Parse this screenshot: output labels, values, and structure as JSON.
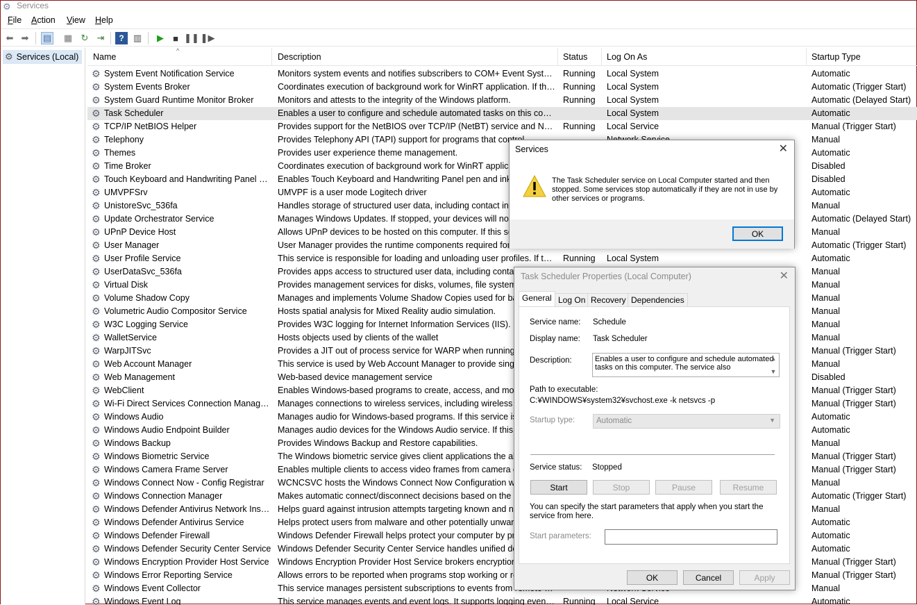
{
  "window": {
    "title": "Services"
  },
  "menu": [
    "File",
    "Action",
    "View",
    "Help"
  ],
  "menu_underline": [
    "F",
    "A",
    "V",
    "H"
  ],
  "toolbar": [
    "back-icon",
    "forward-icon",
    "console-tree-icon",
    "properties-icon",
    "refresh-icon",
    "export-icon",
    "help-icon",
    "show-hide-icon",
    "start-service-icon",
    "stop-service-icon",
    "pause-service-icon",
    "restart-service-icon"
  ],
  "tree": {
    "root": "Services (Local)"
  },
  "columns": {
    "name": "Name",
    "description": "Description",
    "status": "Status",
    "logon": "Log On As",
    "startup": "Startup Type"
  },
  "rows": [
    {
      "name": "System Event Notification Service",
      "desc": "Monitors system events and notifies subscribers to COM+ Event System o...",
      "status": "Running",
      "logon": "Local System",
      "startup": "Automatic"
    },
    {
      "name": "System Events Broker",
      "desc": "Coordinates execution of background work for WinRT application. If this s...",
      "status": "Running",
      "logon": "Local System",
      "startup": "Automatic (Trigger Start)"
    },
    {
      "name": "System Guard Runtime Monitor Broker",
      "desc": "Monitors and attests to the integrity of the Windows platform.",
      "status": "Running",
      "logon": "Local System",
      "startup": "Automatic (Delayed Start)"
    },
    {
      "name": "Task Scheduler",
      "desc": "Enables a user to configure and schedule automated tasks on this comput...",
      "status": "",
      "logon": "Local System",
      "startup": "Automatic",
      "selected": true
    },
    {
      "name": "TCP/IP NetBIOS Helper",
      "desc": "Provides support for the NetBIOS over TCP/IP (NetBT) service and NetBIO...",
      "status": "Running",
      "logon": "Local Service",
      "startup": "Manual (Trigger Start)"
    },
    {
      "name": "Telephony",
      "desc": "Provides Telephony API (TAPI) support for programs that control",
      "status": "",
      "logon": "Network Service",
      "startup": "Manual"
    },
    {
      "name": "Themes",
      "desc": "Provides user experience theme management.",
      "status": "",
      "logon": "",
      "startup": "Automatic"
    },
    {
      "name": "Time Broker",
      "desc": "Coordinates execution of background work for WinRT applicatio",
      "status": "",
      "logon": "",
      "startup": "Disabled"
    },
    {
      "name": "Touch Keyboard and Handwriting Panel Ser...",
      "desc": "Enables Touch Keyboard and Handwriting Panel pen and ink fun",
      "status": "",
      "logon": "",
      "startup": "Disabled"
    },
    {
      "name": "UMVPFSrv",
      "desc": "UMVPF is a user mode Logitech driver",
      "status": "",
      "logon": "",
      "startup": "Automatic"
    },
    {
      "name": "UnistoreSvc_536fa",
      "desc": "Handles storage of structured user data, including contact info,",
      "status": "",
      "logon": "",
      "startup": "Manual"
    },
    {
      "name": "Update Orchestrator Service",
      "desc": "Manages Windows Updates. If stopped, your devices will not be",
      "status": "",
      "logon": "",
      "startup": "Automatic (Delayed Start)"
    },
    {
      "name": "UPnP Device Host",
      "desc": "Allows UPnP devices to be hosted on this computer. If this servi",
      "status": "",
      "logon": "",
      "startup": "Manual"
    },
    {
      "name": "User Manager",
      "desc": "User Manager provides the runtime components required for m",
      "status": "",
      "logon": "",
      "startup": "Automatic (Trigger Start)"
    },
    {
      "name": "User Profile Service",
      "desc": "This service is responsible for loading and unloading user profiles. If this s...",
      "status": "Running",
      "logon": "Local System",
      "startup": "Automatic"
    },
    {
      "name": "UserDataSvc_536fa",
      "desc": "Provides apps access to structured user data, including contact in",
      "status": "",
      "logon": "",
      "startup": "Manual"
    },
    {
      "name": "Virtual Disk",
      "desc": "Provides management services for disks, volumes, file systems, a",
      "status": "",
      "logon": "",
      "startup": "Manual"
    },
    {
      "name": "Volume Shadow Copy",
      "desc": "Manages and implements Volume Shadow Copies used for backu",
      "status": "",
      "logon": "",
      "startup": "Manual"
    },
    {
      "name": "Volumetric Audio Compositor Service",
      "desc": "Hosts spatial analysis for Mixed Reality audio simulation.",
      "status": "",
      "logon": "",
      "startup": "Manual"
    },
    {
      "name": "W3C Logging Service",
      "desc": "Provides W3C logging for Internet Information Services (IIS). If th",
      "status": "",
      "logon": "",
      "startup": "Manual"
    },
    {
      "name": "WalletService",
      "desc": "Hosts objects used by clients of the wallet",
      "status": "",
      "logon": "",
      "startup": "Manual"
    },
    {
      "name": "WarpJITSvc",
      "desc": "Provides a JIT out of process service for WARP when running wit",
      "status": "",
      "logon": "",
      "startup": "Manual (Trigger Start)"
    },
    {
      "name": "Web Account Manager",
      "desc": "This service is used by Web Account Manager to provide single-s",
      "status": "",
      "logon": "",
      "startup": "Manual"
    },
    {
      "name": "Web Management",
      "desc": "Web-based device management service",
      "status": "",
      "logon": "",
      "startup": "Disabled"
    },
    {
      "name": "WebClient",
      "desc": "Enables Windows-based programs to create, access, and modify",
      "status": "",
      "logon": "",
      "startup": "Manual (Trigger Start)"
    },
    {
      "name": "Wi-Fi Direct Services Connection Manager S...",
      "desc": "Manages connections to wireless services, including wireless disp",
      "status": "",
      "logon": "",
      "startup": "Manual (Trigger Start)"
    },
    {
      "name": "Windows Audio",
      "desc": "Manages audio for Windows-based programs.  If this service is st",
      "status": "",
      "logon": "",
      "startup": "Automatic"
    },
    {
      "name": "Windows Audio Endpoint Builder",
      "desc": "Manages audio devices for the Windows Audio service.  If this ser",
      "status": "",
      "logon": "",
      "startup": "Automatic"
    },
    {
      "name": "Windows Backup",
      "desc": "Provides Windows Backup and Restore capabilities.",
      "status": "",
      "logon": "",
      "startup": "Manual"
    },
    {
      "name": "Windows Biometric Service",
      "desc": "The Windows biometric service gives client applications the abilit",
      "status": "",
      "logon": "",
      "startup": "Manual (Trigger Start)"
    },
    {
      "name": "Windows Camera Frame Server",
      "desc": "Enables multiple clients to access video frames from camera devi",
      "status": "",
      "logon": "",
      "startup": "Manual (Trigger Start)"
    },
    {
      "name": "Windows Connect Now - Config Registrar",
      "desc": "WCNCSVC hosts the Windows Connect Now Configuration which",
      "status": "",
      "logon": "",
      "startup": "Manual"
    },
    {
      "name": "Windows Connection Manager",
      "desc": "Makes automatic connect/disconnect decisions based on the net",
      "status": "",
      "logon": "",
      "startup": "Automatic (Trigger Start)"
    },
    {
      "name": "Windows Defender Antivirus Network Inspe...",
      "desc": "Helps guard against intrusion attempts targeting known and new",
      "status": "",
      "logon": "",
      "startup": "Manual"
    },
    {
      "name": "Windows Defender Antivirus Service",
      "desc": "Helps protect users from malware and other potentially unwante",
      "status": "",
      "logon": "",
      "startup": "Automatic"
    },
    {
      "name": "Windows Defender Firewall",
      "desc": "Windows Defender Firewall helps protect your computer by preve",
      "status": "",
      "logon": "",
      "startup": "Automatic"
    },
    {
      "name": "Windows Defender Security Center Service",
      "desc": "Windows Defender Security Center Service handles unified device",
      "status": "",
      "logon": "",
      "startup": "Automatic"
    },
    {
      "name": "Windows Encryption Provider Host Service",
      "desc": "Windows Encryption Provider Host Service brokers encryption rel",
      "status": "",
      "logon": "",
      "startup": "Manual (Trigger Start)"
    },
    {
      "name": "Windows Error Reporting Service",
      "desc": "Allows errors to be reported when programs stop working or resp",
      "status": "",
      "logon": "",
      "startup": "Manual (Trigger Start)"
    },
    {
      "name": "Windows Event Collector",
      "desc": "This service manages persistent subscriptions to events from remote sour...",
      "status": "",
      "logon": "Network Service",
      "startup": "Manual"
    },
    {
      "name": "Windows Event Log",
      "desc": "This service manages events and event logs. It supports logging events, q...",
      "status": "Running",
      "logon": "Local Service",
      "startup": "Automatic"
    }
  ],
  "message_dialog": {
    "title": "Services",
    "message": "The Task Scheduler service on Local Computer started and then stopped. Some services stop automatically if they are not in use by other services or programs.",
    "ok": "OK"
  },
  "properties_dialog": {
    "title": "Task Scheduler Properties (Local Computer)",
    "tabs": [
      "General",
      "Log On",
      "Recovery",
      "Dependencies"
    ],
    "service_name_label": "Service name:",
    "service_name": "Schedule",
    "display_name_label": "Display name:",
    "display_name": "Task Scheduler",
    "description_label": "Description:",
    "description": "Enables a user to configure and schedule automated tasks on this computer. The service also",
    "path_label": "Path to executable:",
    "path": "C:¥WINDOWS¥system32¥svchost.exe -k netsvcs -p",
    "startup_type_label": "Startup type:",
    "startup_type": "Automatic",
    "status_label": "Service status:",
    "status": "Stopped",
    "start": "Start",
    "stop": "Stop",
    "pause": "Pause",
    "resume": "Resume",
    "start_params_note": "You can specify the start parameters that apply when you start the service from here.",
    "start_params_label": "Start parameters:",
    "start_params_value": "",
    "ok": "OK",
    "cancel": "Cancel",
    "apply": "Apply"
  }
}
